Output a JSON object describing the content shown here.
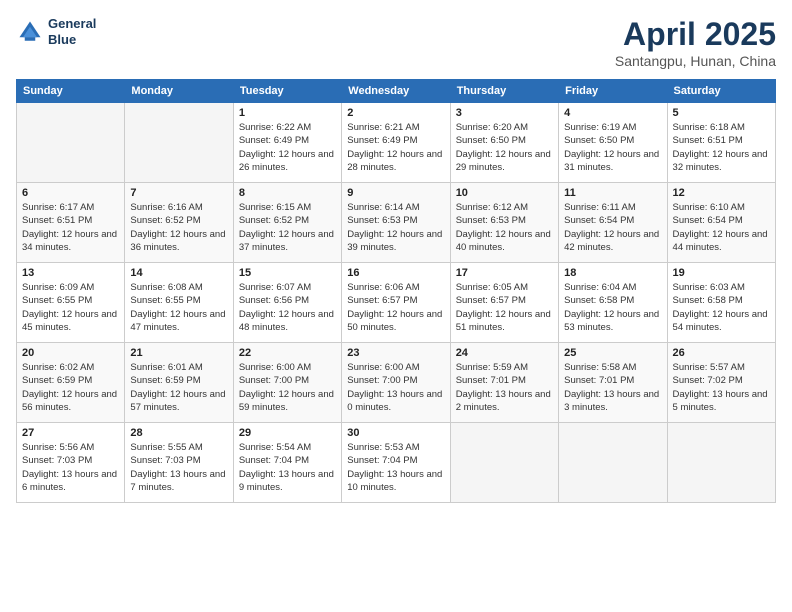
{
  "header": {
    "logo_line1": "General",
    "logo_line2": "Blue",
    "title": "April 2025",
    "subtitle": "Santangpu, Hunan, China"
  },
  "weekdays": [
    "Sunday",
    "Monday",
    "Tuesday",
    "Wednesday",
    "Thursday",
    "Friday",
    "Saturday"
  ],
  "weeks": [
    [
      null,
      null,
      {
        "day": 1,
        "sunrise": "6:22 AM",
        "sunset": "6:49 PM",
        "daylight": "12 hours and 26 minutes."
      },
      {
        "day": 2,
        "sunrise": "6:21 AM",
        "sunset": "6:49 PM",
        "daylight": "12 hours and 28 minutes."
      },
      {
        "day": 3,
        "sunrise": "6:20 AM",
        "sunset": "6:50 PM",
        "daylight": "12 hours and 29 minutes."
      },
      {
        "day": 4,
        "sunrise": "6:19 AM",
        "sunset": "6:50 PM",
        "daylight": "12 hours and 31 minutes."
      },
      {
        "day": 5,
        "sunrise": "6:18 AM",
        "sunset": "6:51 PM",
        "daylight": "12 hours and 32 minutes."
      }
    ],
    [
      {
        "day": 6,
        "sunrise": "6:17 AM",
        "sunset": "6:51 PM",
        "daylight": "12 hours and 34 minutes."
      },
      {
        "day": 7,
        "sunrise": "6:16 AM",
        "sunset": "6:52 PM",
        "daylight": "12 hours and 36 minutes."
      },
      {
        "day": 8,
        "sunrise": "6:15 AM",
        "sunset": "6:52 PM",
        "daylight": "12 hours and 37 minutes."
      },
      {
        "day": 9,
        "sunrise": "6:14 AM",
        "sunset": "6:53 PM",
        "daylight": "12 hours and 39 minutes."
      },
      {
        "day": 10,
        "sunrise": "6:12 AM",
        "sunset": "6:53 PM",
        "daylight": "12 hours and 40 minutes."
      },
      {
        "day": 11,
        "sunrise": "6:11 AM",
        "sunset": "6:54 PM",
        "daylight": "12 hours and 42 minutes."
      },
      {
        "day": 12,
        "sunrise": "6:10 AM",
        "sunset": "6:54 PM",
        "daylight": "12 hours and 44 minutes."
      }
    ],
    [
      {
        "day": 13,
        "sunrise": "6:09 AM",
        "sunset": "6:55 PM",
        "daylight": "12 hours and 45 minutes."
      },
      {
        "day": 14,
        "sunrise": "6:08 AM",
        "sunset": "6:55 PM",
        "daylight": "12 hours and 47 minutes."
      },
      {
        "day": 15,
        "sunrise": "6:07 AM",
        "sunset": "6:56 PM",
        "daylight": "12 hours and 48 minutes."
      },
      {
        "day": 16,
        "sunrise": "6:06 AM",
        "sunset": "6:57 PM",
        "daylight": "12 hours and 50 minutes."
      },
      {
        "day": 17,
        "sunrise": "6:05 AM",
        "sunset": "6:57 PM",
        "daylight": "12 hours and 51 minutes."
      },
      {
        "day": 18,
        "sunrise": "6:04 AM",
        "sunset": "6:58 PM",
        "daylight": "12 hours and 53 minutes."
      },
      {
        "day": 19,
        "sunrise": "6:03 AM",
        "sunset": "6:58 PM",
        "daylight": "12 hours and 54 minutes."
      }
    ],
    [
      {
        "day": 20,
        "sunrise": "6:02 AM",
        "sunset": "6:59 PM",
        "daylight": "12 hours and 56 minutes."
      },
      {
        "day": 21,
        "sunrise": "6:01 AM",
        "sunset": "6:59 PM",
        "daylight": "12 hours and 57 minutes."
      },
      {
        "day": 22,
        "sunrise": "6:00 AM",
        "sunset": "7:00 PM",
        "daylight": "12 hours and 59 minutes."
      },
      {
        "day": 23,
        "sunrise": "6:00 AM",
        "sunset": "7:00 PM",
        "daylight": "13 hours and 0 minutes."
      },
      {
        "day": 24,
        "sunrise": "5:59 AM",
        "sunset": "7:01 PM",
        "daylight": "13 hours and 2 minutes."
      },
      {
        "day": 25,
        "sunrise": "5:58 AM",
        "sunset": "7:01 PM",
        "daylight": "13 hours and 3 minutes."
      },
      {
        "day": 26,
        "sunrise": "5:57 AM",
        "sunset": "7:02 PM",
        "daylight": "13 hours and 5 minutes."
      }
    ],
    [
      {
        "day": 27,
        "sunrise": "5:56 AM",
        "sunset": "7:03 PM",
        "daylight": "13 hours and 6 minutes."
      },
      {
        "day": 28,
        "sunrise": "5:55 AM",
        "sunset": "7:03 PM",
        "daylight": "13 hours and 7 minutes."
      },
      {
        "day": 29,
        "sunrise": "5:54 AM",
        "sunset": "7:04 PM",
        "daylight": "13 hours and 9 minutes."
      },
      {
        "day": 30,
        "sunrise": "5:53 AM",
        "sunset": "7:04 PM",
        "daylight": "13 hours and 10 minutes."
      },
      null,
      null,
      null
    ]
  ]
}
